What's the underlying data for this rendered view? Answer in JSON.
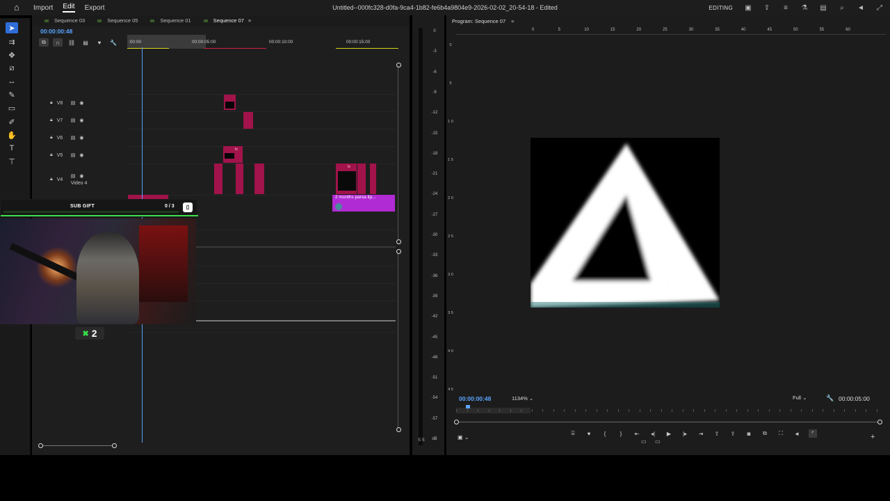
{
  "menu": {
    "items": [
      "Import",
      "Edit",
      "Export"
    ],
    "active": "Edit",
    "title": "Untitled--000fc328-d0fa-9ca4-1b82-fe6b4a9804e9-2026-02-02_20-54-18 - Edited",
    "mode": "EDITING"
  },
  "timeline": {
    "tabs": [
      "Sequence 03",
      "Sequence 05",
      "Sequence 01",
      "Sequence 07"
    ],
    "active_tab": "Sequence 07",
    "timecode": "00:00:00:48",
    "ruler_labels": [
      ":00:00",
      "00:00:05:00",
      "00:00:10:00",
      "00:00:15:00"
    ],
    "tracks": [
      {
        "name": "V8"
      },
      {
        "name": "V7"
      },
      {
        "name": "V6"
      },
      {
        "name": "V5"
      },
      {
        "name": "V4",
        "subname": "Video 4"
      }
    ],
    "clip_label": "2 months  parsa lip...",
    "fx_label": "fx"
  },
  "overlay": {
    "title": "SUB GIFT",
    "count": "0 / 3",
    "progress": 0.0,
    "multiplier": "2",
    "multiplier_prefix": "✖",
    "accent": "#3ee04a"
  },
  "meter": {
    "labels": [
      "0",
      "-3",
      "-6",
      "-9",
      "-12",
      "-15",
      "-18",
      "-21",
      "-24",
      "-27",
      "-30",
      "-33",
      "-36",
      "-39",
      "-42",
      "-45",
      "-48",
      "-51",
      "-54",
      "-57",
      "dB"
    ],
    "footer": "S S"
  },
  "program": {
    "title": "Program: Sequence 07",
    "ruler": [
      "0",
      "5",
      "10",
      "15",
      "20",
      "25",
      "30",
      "35",
      "40",
      "45",
      "50",
      "55",
      "60"
    ],
    "vruler": [
      "0",
      "5",
      "1 0",
      "1 5",
      "2 0",
      "2 5",
      "3 0",
      "3 5",
      "4 0",
      "4 5"
    ],
    "timecode": "00:00:00:48",
    "zoom": "1134%",
    "quality": "Full",
    "duration": "00:00:05:00"
  },
  "colors": {
    "accent_blue": "#5aa5ff",
    "clip_red": "#a1134a",
    "clip_purple": "#b12bd4"
  }
}
